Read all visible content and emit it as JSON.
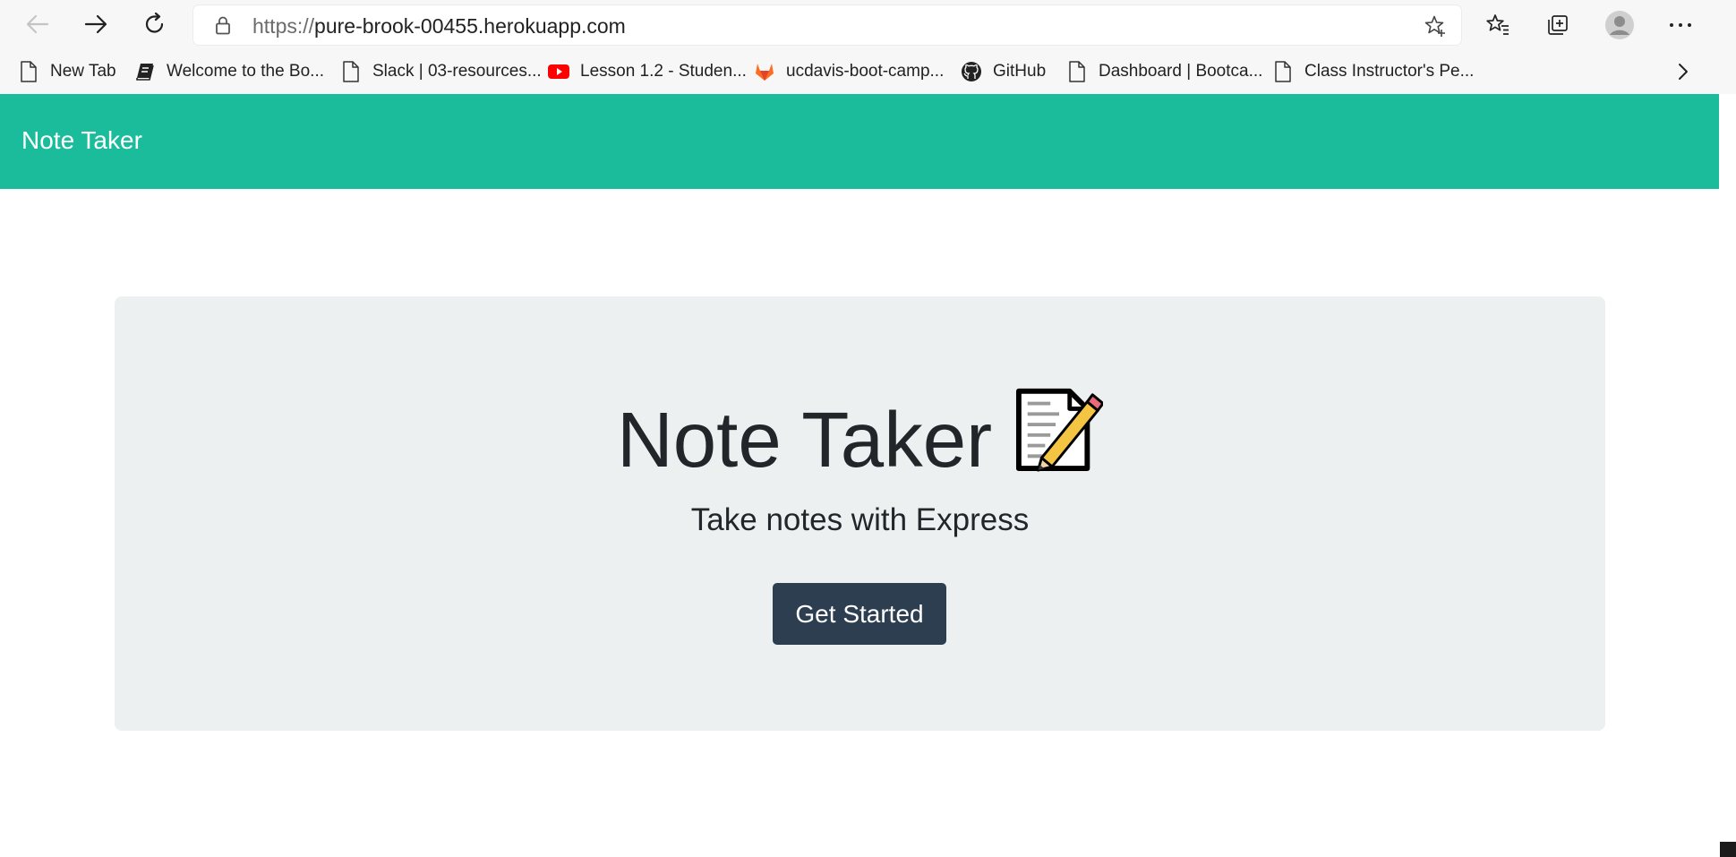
{
  "browser": {
    "url_scheme": "https://",
    "url_host": "pure-brook-00455.herokuapp.com",
    "icons": {
      "back": "arrow-left-icon",
      "forward": "arrow-right-icon",
      "reload": "reload-icon",
      "lock": "lock-icon",
      "add_favorite": "star-add-icon",
      "favorites": "favorites-icon",
      "collections": "collections-icon",
      "profile": "avatar-icon",
      "menu": "ellipsis-icon"
    }
  },
  "bookmarks": [
    {
      "label": "New Tab",
      "icon": "page-icon"
    },
    {
      "label": "Welcome to the Bo...",
      "icon": "book-icon"
    },
    {
      "label": "Slack | 03-resources...",
      "icon": "page-icon"
    },
    {
      "label": "Lesson 1.2 - Studen...",
      "icon": "youtube-icon"
    },
    {
      "label": "ucdavis-boot-camp...",
      "icon": "gitlab-icon"
    },
    {
      "label": "GitHub",
      "icon": "github-icon"
    },
    {
      "label": "Dashboard | Bootca...",
      "icon": "page-icon"
    },
    {
      "label": "Class Instructor's Pe...",
      "icon": "page-icon"
    }
  ],
  "page": {
    "navbar_brand": "Note Taker",
    "hero_title": "Note Taker",
    "hero_subtitle": "Take notes with Express",
    "cta_label": "Get Started"
  },
  "colors": {
    "navbar": "#1abc9c",
    "jumbotron": "#ecf0f1",
    "button": "#2c3e50",
    "text": "#22262a"
  }
}
